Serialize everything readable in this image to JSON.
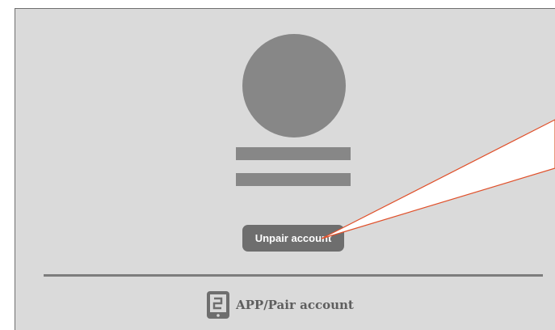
{
  "card": {
    "avatar_icon": "user-avatar-placeholder",
    "unpair_label": "Unpair account"
  },
  "footer": {
    "pair_icon": "phone-app-icon",
    "pair_label": "APP/Pair account"
  },
  "colors": {
    "background": "#dadada",
    "placeholder": "#878787",
    "button": "#6e6e6e",
    "callout_stroke": "#e0502a"
  }
}
